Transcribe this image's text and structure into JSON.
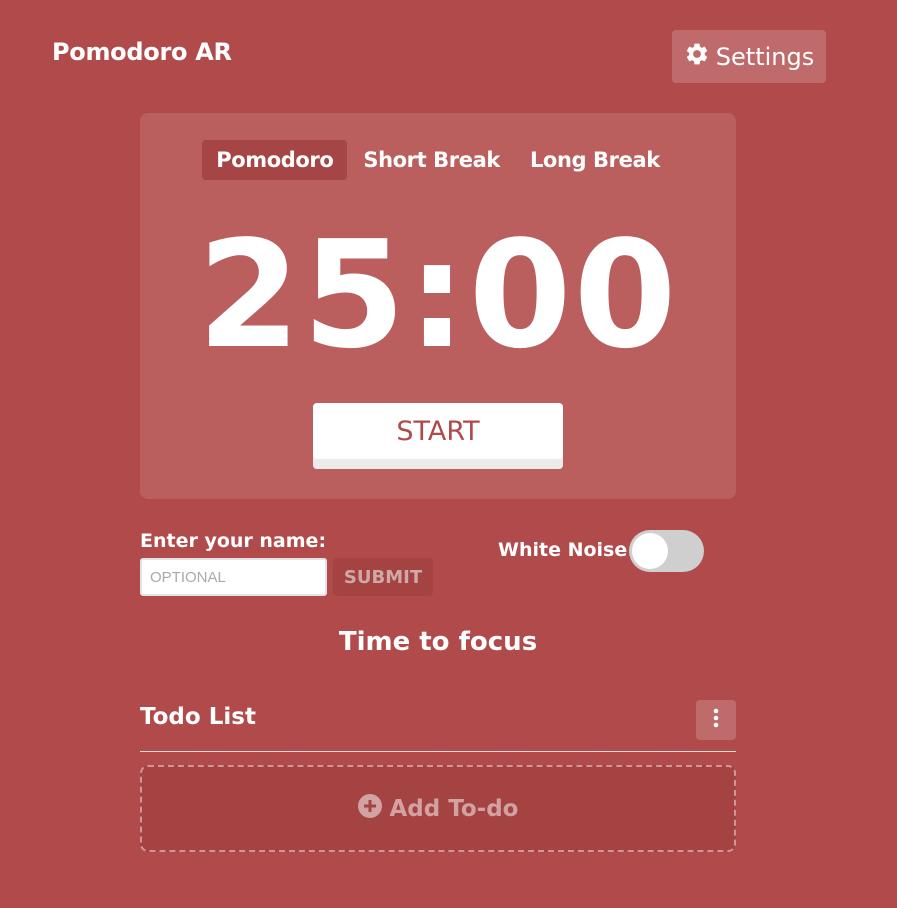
{
  "app": {
    "title": "Pomodoro AR",
    "settings_label": "Settings",
    "settings_icon": "gear-icon"
  },
  "timer": {
    "tabs": [
      {
        "label": "Pomodoro",
        "active": true
      },
      {
        "label": "Short Break",
        "active": false
      },
      {
        "label": "Long Break",
        "active": false
      }
    ],
    "time": "25:00",
    "start_label": "START"
  },
  "name_form": {
    "label": "Enter your name:",
    "placeholder": "OPTIONAL",
    "value": "",
    "submit_label": "SUBMIT"
  },
  "white_noise": {
    "label": "White Noise",
    "enabled": false
  },
  "status": "Time to focus",
  "todo": {
    "title": "Todo List",
    "menu_icon": "kebab-menu-icon",
    "add_label": "Add To-do",
    "add_icon": "plus-circle-icon"
  },
  "colors": {
    "background": "#b14b4b",
    "card": "#bb5e5e",
    "active_tab": "#a54545",
    "accent_text": "#b04a4a"
  }
}
